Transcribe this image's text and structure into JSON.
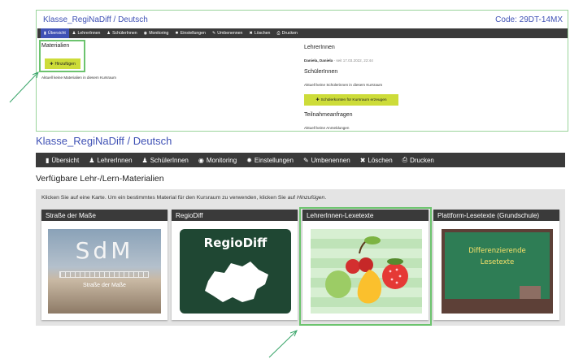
{
  "top_panel": {
    "title": "Klasse_RegiNaDiff / Deutsch",
    "code": "Code: 29DT-14MX",
    "toolbar": [
      {
        "icon": "book-icon",
        "glyph": "▮",
        "label": "Übersicht",
        "active": true
      },
      {
        "icon": "person-icon",
        "glyph": "♟",
        "label": "LehrerInnen"
      },
      {
        "icon": "person-icon",
        "glyph": "♟",
        "label": "SchülerInnen"
      },
      {
        "icon": "eye-icon",
        "glyph": "◉",
        "label": "Monitoring"
      },
      {
        "icon": "gear-icon",
        "glyph": "✹",
        "label": "Einstellungen"
      },
      {
        "icon": "edit-icon",
        "glyph": "✎",
        "label": "Umbenennen"
      },
      {
        "icon": "close-icon",
        "glyph": "✖",
        "label": "Löschen"
      },
      {
        "icon": "print-icon",
        "glyph": "⎙",
        "label": "Drucken"
      }
    ],
    "materials_heading": "Materialien",
    "add_button": "Hinzufügen",
    "materials_note": "Aktuell keine Materialien in diesem Kursraum",
    "teachers_heading": "LehrerInnen",
    "teacher_entry": "Daniela, Daniela",
    "teacher_since": " - seit 17.03.2022, 22:44",
    "students_heading": "SchülerInnen",
    "students_note": "Aktuell keine Schülerinnen in diesem Kursraum",
    "students_button": "Schülerkonten für Kursraum erzeugen",
    "requests_heading": "Teilnahmeanfragen",
    "requests_note": "Aktuell keine Anmeldungen"
  },
  "main": {
    "title": "Klasse_RegiNaDiff / Deutsch",
    "toolbar": [
      {
        "icon": "book-icon",
        "glyph": "▮",
        "label": "Übersicht"
      },
      {
        "icon": "person-icon",
        "glyph": "♟",
        "label": "LehrerInnen"
      },
      {
        "icon": "person-icon",
        "glyph": "♟",
        "label": "SchülerInnen"
      },
      {
        "icon": "eye-icon",
        "glyph": "◉",
        "label": "Monitoring"
      },
      {
        "icon": "gear-icon",
        "glyph": "✹",
        "label": "Einstellungen"
      },
      {
        "icon": "edit-icon",
        "glyph": "✎",
        "label": "Umbenennen"
      },
      {
        "icon": "close-icon",
        "glyph": "✖",
        "label": "Löschen"
      },
      {
        "icon": "print-icon",
        "glyph": "⎙",
        "label": "Drucken"
      }
    ],
    "heading": "Verfügbare Lehr-/Lern-Materialien",
    "instruction": "Klicken Sie auf eine Karte. Um ein bestimmtes Material für den Kursraum zu verwenden, klicken Sie auf ",
    "instruction_em": "Hinzufügen",
    "instruction_end": ".",
    "cards": [
      {
        "title": "Straße der Maße",
        "image_text": "SdM",
        "image_caption": "Straße der Maße"
      },
      {
        "title": "RegioDiff",
        "image_text": "RegioDiff"
      },
      {
        "title": "LehrerInnen-Lexetexte"
      },
      {
        "title": "Plattform-Lesetexte (Grundschule)",
        "image_text_1": "Differenzierende",
        "image_text_2": "Lesetexte"
      }
    ]
  },
  "colors": {
    "accent": "#3f51b5",
    "toolbar": "#3a3a3a",
    "lime": "#cddc39",
    "highlight": "#6cc36e"
  }
}
